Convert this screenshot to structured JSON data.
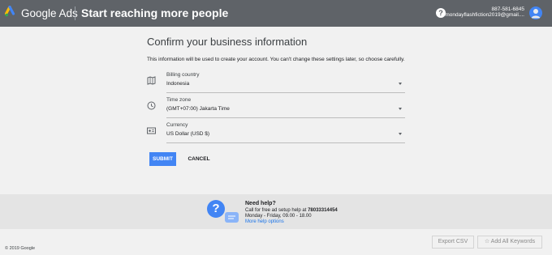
{
  "header": {
    "brand": "Google Ads",
    "title": "Start reaching more people",
    "help_icon": "help-circle-icon",
    "account_phone": "887-581-6845",
    "account_email": "mondayflashfiction2019@gmail....",
    "avatar_icon": "account-avatar-icon"
  },
  "form": {
    "heading": "Confirm your business information",
    "intro": "This information will be used to create your account. You can't change these settings later, so choose carefully.",
    "fields": [
      {
        "label": "Billing country",
        "value": "Indonesia",
        "icon": "map-icon"
      },
      {
        "label": "Time zone",
        "value": "(GMT+07:00) Jakarta Time",
        "icon": "clock-icon"
      },
      {
        "label": "Currency",
        "value": "US Dollar (USD $)",
        "icon": "currency-card-icon"
      }
    ],
    "submit_label": "SUBMIT",
    "cancel_label": "CANCEL"
  },
  "help": {
    "title": "Need help?",
    "call_prefix": "Call for free ad setup help at",
    "phone": "78033314454",
    "hours": "Monday - Friday, 09.00 - 18.00",
    "more_link": "More help options"
  },
  "footer": {
    "copyright": "© 2019 Google",
    "export_label": "Export CSV",
    "add_label": "Add All Keywords"
  },
  "colors": {
    "topbar": "#5f6368",
    "accent": "#4285f4",
    "link": "#1a73e8"
  }
}
